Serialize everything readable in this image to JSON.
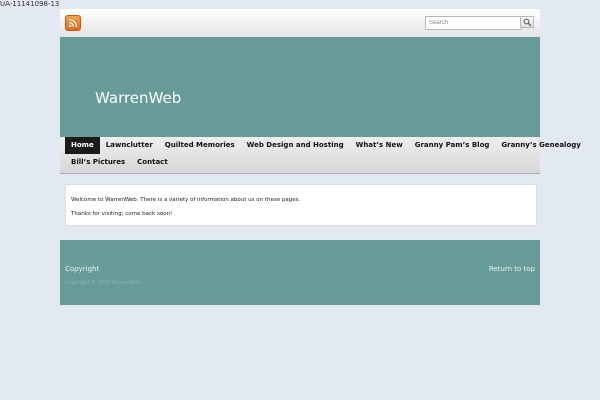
{
  "tracking_id": "UA-11141098-13",
  "search": {
    "placeholder": "Search"
  },
  "site": {
    "title": "WarrenWeb"
  },
  "nav": {
    "row1": [
      "Home",
      "Lawnclutter",
      "Quilted Memories",
      "Web Design and Hosting",
      "What’s New",
      "Granny Pam’s Blog",
      "Granny’s Genealogy"
    ],
    "row2": [
      "Bill’s Pictures",
      "Contact"
    ],
    "active": "Home"
  },
  "content": {
    "paragraph1": "Welcome to WarrenWeb. There is a variety of information about us on these pages.",
    "paragraph2": "Thanks for visiting; come back soon!"
  },
  "footer": {
    "copyright_label": "Copyright",
    "copyright_text": "Copyright © 2010 WarrenWeb",
    "return_to_top": "Return to top"
  },
  "colors": {
    "header_bg": "#679b98",
    "page_bg": "#e2e9f1",
    "nav_active_bg": "#1a1a1a"
  },
  "icons": {
    "feed": "rss-icon",
    "search": "magnifier-icon"
  }
}
